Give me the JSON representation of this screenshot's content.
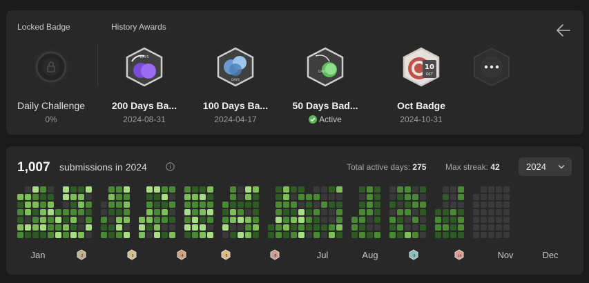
{
  "badges_section": {
    "locked_title": "Locked Badge",
    "history_title": "History Awards",
    "locked": {
      "name": "Daily Challenge",
      "progress": "0%"
    },
    "awards": [
      {
        "name": "200 Days Ba...",
        "date": "2024-08-31",
        "icon": "200-days-badge-icon"
      },
      {
        "name": "100 Days Ba...",
        "date": "2024-04-17",
        "icon": "100-days-badge-icon"
      },
      {
        "name": "50 Days Bad...",
        "status": "Active",
        "icon": "50-days-badge-icon"
      },
      {
        "name": "Oct Badge",
        "date": "2024-10-31",
        "icon": "oct-badge-icon"
      }
    ],
    "oct_badge_text": {
      "number": "10",
      "month": "OCT"
    },
    "badge_day_text": "DAYS",
    "more_icon": "more-badges-icon",
    "back_icon": "back-arrow-icon"
  },
  "heatmap": {
    "count": "1,007",
    "count_label": "submissions in 2024",
    "active_days_label": "Total active days:",
    "active_days": "275",
    "max_streak_label": "Max streak:",
    "max_streak": "42",
    "year": "2024",
    "months": [
      "Jan",
      "Jul",
      "Aug",
      "Nov",
      "Dec"
    ],
    "monthly_badge_numbers": [
      "2",
      "3",
      "4",
      "5",
      "6",
      "9",
      "10"
    ],
    "colors": {
      "empty": "#3a3a3a",
      "level1": "#2e5a24",
      "level2": "#4a8a34",
      "level3": "#7ebf5a",
      "level4": "#a8dd86"
    }
  }
}
